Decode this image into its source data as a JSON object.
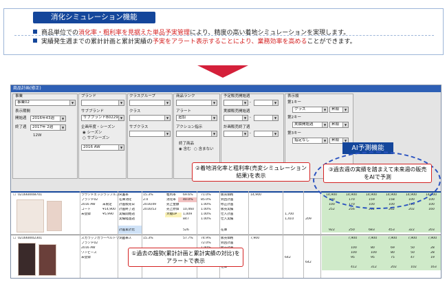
{
  "header": {
    "title": "消化シミュレーション機能",
    "bullet1_a": "商品単位での",
    "bullet1_b": "消化率・粗利率を見据えた単品予実管理",
    "bullet1_c": "により、精度の高い着地シミュレーションを実現します。",
    "bullet2_a": "実績発生週までの累計計画と累計実績の",
    "bullet2_b": "予実をアラート表示することにより、業務効率を高める",
    "bullet2_c": "ことができます。"
  },
  "app": {
    "window_title": "商品計画(修正)",
    "labels": {
      "business": "事業",
      "business_val": "事業02",
      "display_period": "表示期間",
      "start_week": "開始週",
      "start_val": "2016年43週",
      "end_week": "終了週",
      "end_val": "2017年 2週",
      "weeks": "12W",
      "brand": "ブランド",
      "sub_brand": "サブブランド",
      "sub_brand_val": "サブブランドB0229",
      "season_title": "企画年度・シーズン",
      "season_opt1": "シーズン",
      "season_opt2": "サブシーズン",
      "season_val": "2016 AW",
      "class_group": "クラスグループ",
      "class": "クラス",
      "subclass": "サブクラス",
      "product_rank": "商品ランク",
      "alert": "アラート",
      "alert_val": "追加",
      "action": "アクション指示",
      "end_item": "終了商品",
      "end_opt1": "含む",
      "end_opt2": "含まない",
      "forecast_start": "予定販売開始週",
      "actual_start": "実績販売開始週",
      "plan_end": "計画販売終了週",
      "display_order": "表示順",
      "key1": "第1キー",
      "key1_val": "クラス",
      "key2": "第2キー",
      "key2_val": "実績開始週",
      "key3": "第3キー",
      "key3_val": "指定なし",
      "asc": "昇順",
      "dash": "-"
    },
    "rows": [
      {
        "code": "021660008701",
        "info": [
          "ラウンドエッジラッフルコート",
          "ブランド02",
          "2016 AW",
          "コート",
          "未登録"
        ],
        "status": "未限定",
        "prices": [
          "¥14,900",
          "¥5,990"
        ],
        "metrics": [
          "欠品率",
          "在庫消化",
          "計画販売日",
          "計画終了週",
          "実績開始週",
          "実績経過週",
          "計画累計比"
        ],
        "metric_vals": [
          "15.3%",
          "2.0",
          "2016/49",
          "2016/53",
          "",
          "",
          ""
        ],
        "metrics2": [
          "粗利率",
          "消化率",
          "売上金額",
          "売上原価",
          "大幅UP",
          "",
          ""
        ],
        "metric2_vals": [
          "69.6%",
          "40.0%",
          "",
          "10,460",
          "1,009",
          "847",
          "526"
        ],
        "pct": [
          "71.0%",
          "85.0%",
          "1.00%",
          "1.00%",
          "1.00%",
          "1.00%",
          "1.00%"
        ],
        "metrics3": [
          "販売価格",
          "到回計画",
          "修正計画",
          "販売実績",
          "仕入計画",
          "仕入実績",
          "在庫"
        ],
        "price": "14,900",
        "nums": [
          "1,700",
          "1,410",
          "209"
        ],
        "weeks": [
          [
            "14,900",
            "14,900",
            "14,900",
            "14,900",
            "14,900",
            "14,900"
          ],
          [
            "100",
            "170",
            "159",
            "158",
            "100",
            "100"
          ],
          [
            "100",
            "170",
            "100",
            "100",
            "100",
            "100"
          ],
          [
            "252",
            "256",
            "252",
            "262",
            "202",
            "160"
          ],
          [
            "922",
            "250",
            "683",
            "453",
            "322",
            "203"
          ]
        ]
      },
      {
        "code": "021660002301",
        "info": [
          "スカラップカラーベルトワンピース",
          "ブランド02",
          "2016 AW",
          "ワンピース",
          "未登録"
        ],
        "metrics": [
          "欠品率"
        ],
        "metric_vals": [
          "15.3%"
        ],
        "metric2_vals": [
          "57.7%"
        ],
        "pct": [
          "74.9%",
          "72.0%",
          "1.00%",
          "1.00%",
          "1.00%",
          "1.00%"
        ],
        "nums": [
          "642",
          "642"
        ],
        "price": "7,900",
        "weeks": [
          [
            "7,900",
            "7,900",
            "7,900",
            "7,900",
            "7,900"
          ],
          [
            "100",
            "80",
            "69",
            "50",
            "28"
          ],
          [
            "100",
            "100",
            "80",
            "50",
            "28"
          ],
          [
            "95",
            "95",
            "75",
            "47",
            "19"
          ],
          [
            "412",
            "312",
            "202",
            "102",
            "163"
          ]
        ]
      }
    ]
  },
  "ai_badge": "AI予測機能",
  "callouts": {
    "c1": "①過去の趨勢(累計計画と累計実績の対比)をアラートで表示",
    "c2": "②着地消化率と粗利率(売変シミュレーション結果)を表示",
    "c3": "③過去週の実績を踏まえて未来週の販売をAIで予測"
  },
  "colors": {
    "navy": "#14469b",
    "red": "#d42020",
    "blue_dash": "#2b53c0"
  }
}
